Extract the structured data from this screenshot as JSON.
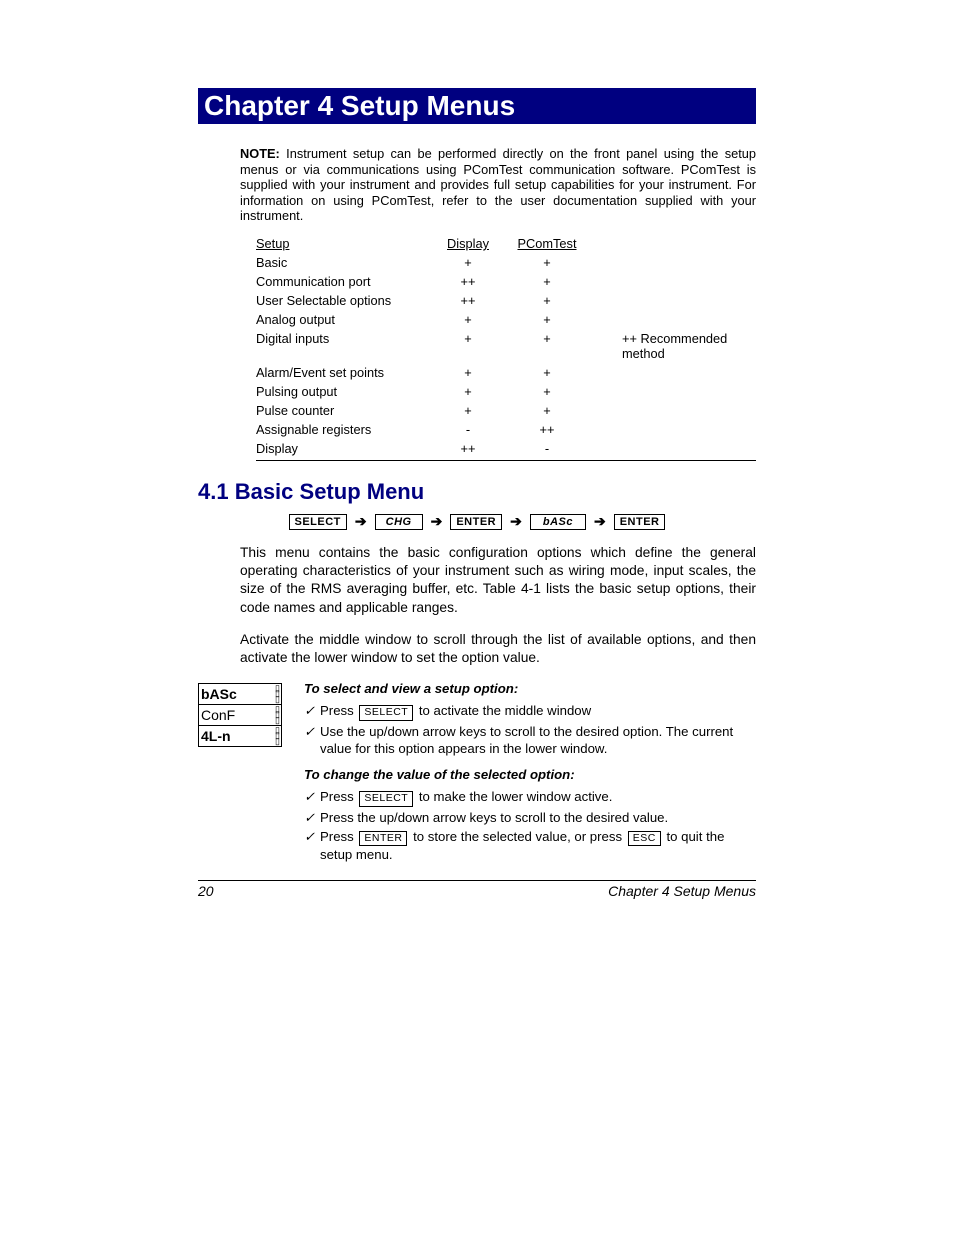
{
  "chapter_title": "Chapter 4  Setup Menus",
  "note": {
    "label": "NOTE:",
    "text": "Instrument setup can be performed directly on the front panel using the setup menus or via communications using PComTest communication software. PComTest is supplied with your instrument and provides full setup capabilities for your instrument. For information on using PComTest, refer to the user documentation supplied with your instrument."
  },
  "table": {
    "headers": {
      "setup": "Setup",
      "display": "Display",
      "pcomtest": "PComTest"
    },
    "legend": "++ Recommended method",
    "rows": [
      {
        "setup": "Basic",
        "display": "+",
        "pcomtest": "+"
      },
      {
        "setup": "Communication port",
        "display": "++",
        "pcomtest": "+"
      },
      {
        "setup": "User Selectable options",
        "display": "++",
        "pcomtest": "+"
      },
      {
        "setup": "Analog output",
        "display": "+",
        "pcomtest": "+"
      },
      {
        "setup": "Digital inputs",
        "display": "+",
        "pcomtest": "+"
      },
      {
        "setup": "Alarm/Event set points",
        "display": "+",
        "pcomtest": "+"
      },
      {
        "setup": "Pulsing output",
        "display": "+",
        "pcomtest": "+"
      },
      {
        "setup": "Pulse counter",
        "display": "+",
        "pcomtest": "+"
      },
      {
        "setup": "Assignable registers",
        "display": "-",
        "pcomtest": "++"
      },
      {
        "setup": "Display",
        "display": "++",
        "pcomtest": "-"
      }
    ]
  },
  "section": {
    "heading": "4.1  Basic Setup Menu",
    "nav": [
      "SELECT",
      "CHG",
      "ENTER",
      "bASc",
      "ENTER"
    ],
    "para1": "This menu contains the basic configuration options which define the general operating characteristics of your instrument such as wiring mode, input scales, the size of the RMS averaging buffer, etc. Table 4-1 lists the basic setup options, their code names and applicable ranges.",
    "para2": "Activate the middle window to scroll through the list of available options, and then activate the lower window to set the option value."
  },
  "lcd": [
    "bASc",
    "ConF",
    "4L-n"
  ],
  "instructions": {
    "title1": "To select and view a setup option:",
    "items1": [
      {
        "pre": "Press ",
        "key": "SELECT",
        "post": " to activate the middle window"
      },
      {
        "text": "Use the up/down arrow keys to scroll to the desired option. The current value for this option appears in the lower window."
      }
    ],
    "title2": "To change the value of the selected option:",
    "items2": [
      {
        "pre": "Press ",
        "key": "SELECT",
        "post": " to make the lower window active."
      },
      {
        "text": "Press the up/down arrow keys to scroll to the desired value."
      },
      {
        "pre": "Press ",
        "key": "ENTER",
        "post_pre": " to store the selected value, or press ",
        "key2": "ESC",
        "post": " to quit the setup menu."
      }
    ]
  },
  "footer": {
    "page": "20",
    "label": "Chapter 4  Setup Menus"
  }
}
